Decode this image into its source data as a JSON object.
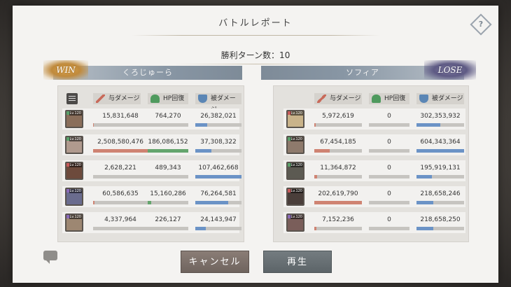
{
  "title": "バトルレポート",
  "turns_label": "勝利ターン数：10",
  "left_team": {
    "name": "くろじゅーら",
    "badge": "WIN"
  },
  "right_team": {
    "name": "ソフィア",
    "badge": "LOSE"
  },
  "columns": {
    "damage": "与ダメージ",
    "heal": "HP回復",
    "taken": "被ダメージ"
  },
  "left_rows": [
    {
      "level": "Lv.120",
      "damage": "15,831,648",
      "heal": "764,270",
      "taken": "26,382,021",
      "damage_pct": 0.01,
      "heal_pct": 0.0,
      "taken_pct": 0.25
    },
    {
      "level": "Lv.120",
      "damage": "2,508,580,476",
      "heal": "186,086,152",
      "taken": "37,308,322",
      "damage_pct": 1.0,
      "heal_pct": 1.0,
      "taken_pct": 0.35
    },
    {
      "level": "Lv.120",
      "damage": "2,628,221",
      "heal": "489,343",
      "taken": "107,462,668",
      "damage_pct": 0.0,
      "heal_pct": 0.0,
      "taken_pct": 1.0
    },
    {
      "level": "Lv.120",
      "damage": "60,586,635",
      "heal": "15,160,286",
      "taken": "76,264,581",
      "damage_pct": 0.03,
      "heal_pct": 0.08,
      "taken_pct": 0.71
    },
    {
      "level": "Lv.120",
      "damage": "4,337,964",
      "heal": "226,127",
      "taken": "24,143,947",
      "damage_pct": 0.0,
      "heal_pct": 0.0,
      "taken_pct": 0.22
    }
  ],
  "right_rows": [
    {
      "level": "Lv.120",
      "damage": "5,972,619",
      "heal": "0",
      "taken": "302,353,932",
      "damage_pct": 0.03,
      "heal_pct": 0,
      "taken_pct": 0.5
    },
    {
      "level": "Lv.120",
      "damage": "67,454,185",
      "heal": "0",
      "taken": "604,343,364",
      "damage_pct": 0.33,
      "heal_pct": 0,
      "taken_pct": 1.0
    },
    {
      "level": "Lv.120",
      "damage": "11,364,872",
      "heal": "0",
      "taken": "195,919,131",
      "damage_pct": 0.06,
      "heal_pct": 0,
      "taken_pct": 0.32
    },
    {
      "level": "Lv.120",
      "damage": "202,619,790",
      "heal": "0",
      "taken": "218,658,246",
      "damage_pct": 1.0,
      "heal_pct": 0,
      "taken_pct": 0.36
    },
    {
      "level": "Lv.120",
      "damage": "7,152,236",
      "heal": "0",
      "taken": "218,658,250",
      "damage_pct": 0.04,
      "heal_pct": 0,
      "taken_pct": 0.36
    }
  ],
  "buttons": {
    "cancel": "キャンセル",
    "play": "再生"
  },
  "colors": {
    "damage_bar": "#cf8372",
    "heal_bar": "#64a56d",
    "taken_bar": "#6b93c6",
    "left_avatars": [
      "#8a6e5a",
      "#b09a8e",
      "#6d4a3c",
      "#6a6c8e",
      "#9d8772"
    ],
    "right_avatars": [
      "#c9b38a",
      "#8e7a6c",
      "#5c5a52",
      "#4a3e3a",
      "#7a5e5a"
    ],
    "left_rarity": [
      "#5aa06a",
      "#5aa06a",
      "#c65a5a",
      "#8a6ab8",
      "#8a6ab8"
    ],
    "right_rarity": [
      "#c65a5a",
      "#5aa06a",
      "#5aa06a",
      "#c65a5a",
      "#8a6ab8"
    ]
  }
}
